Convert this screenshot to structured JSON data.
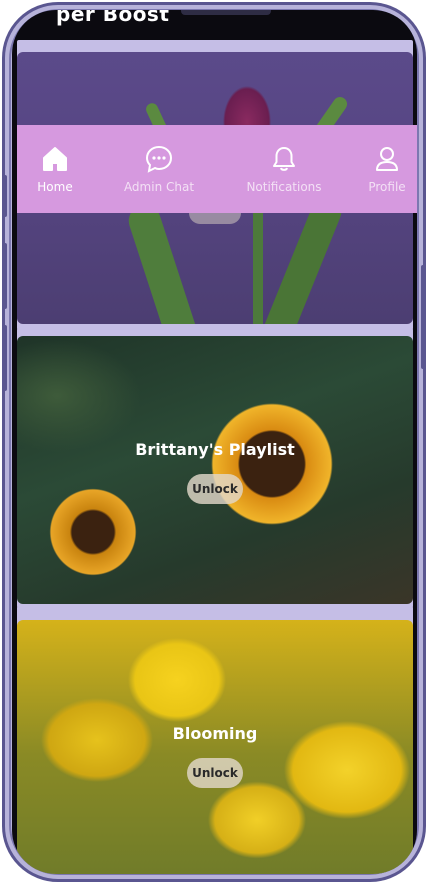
{
  "header": {
    "title_fragment": "per Boost"
  },
  "nav": {
    "items": [
      {
        "label": "Home",
        "icon": "home-icon",
        "active": true
      },
      {
        "label": "Admin Chat",
        "icon": "chat-bubble-icon",
        "active": false
      },
      {
        "label": "Notifications",
        "icon": "bell-icon",
        "active": false
      },
      {
        "label": "Profile",
        "icon": "user-icon",
        "active": false
      }
    ],
    "color": "#d699df"
  },
  "cards": [
    {
      "title": "",
      "unlock_label": "",
      "image": "purple tulip"
    },
    {
      "title": "Brittany's Playlist",
      "unlock_label": "Unlock",
      "image": "sunflowers"
    },
    {
      "title": "Blooming",
      "unlock_label": "Unlock",
      "image": "yellow daffodils"
    }
  ],
  "colors": {
    "card_frame": "#c5bee6",
    "phone_frame": "#5a5690"
  }
}
